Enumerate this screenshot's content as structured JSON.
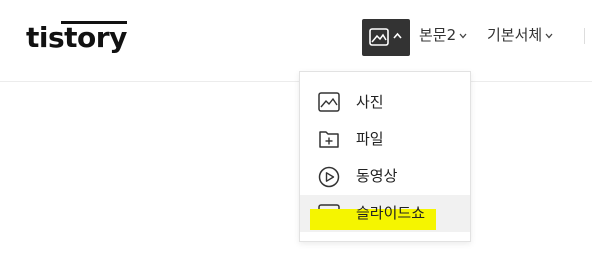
{
  "header": {
    "logo": "tistory",
    "toolbar": {
      "image_button_icon": "image-icon",
      "paragraph_style": "본문2",
      "font_family": "기본서체"
    }
  },
  "insert_menu": {
    "items": [
      {
        "label": "사진",
        "icon": "photo-icon"
      },
      {
        "label": "파일",
        "icon": "file-add-icon"
      },
      {
        "label": "동영상",
        "icon": "video-play-icon"
      },
      {
        "label": "슬라이드쇼",
        "icon": "slideshow-icon"
      }
    ],
    "highlight_color": "#f5f500"
  }
}
